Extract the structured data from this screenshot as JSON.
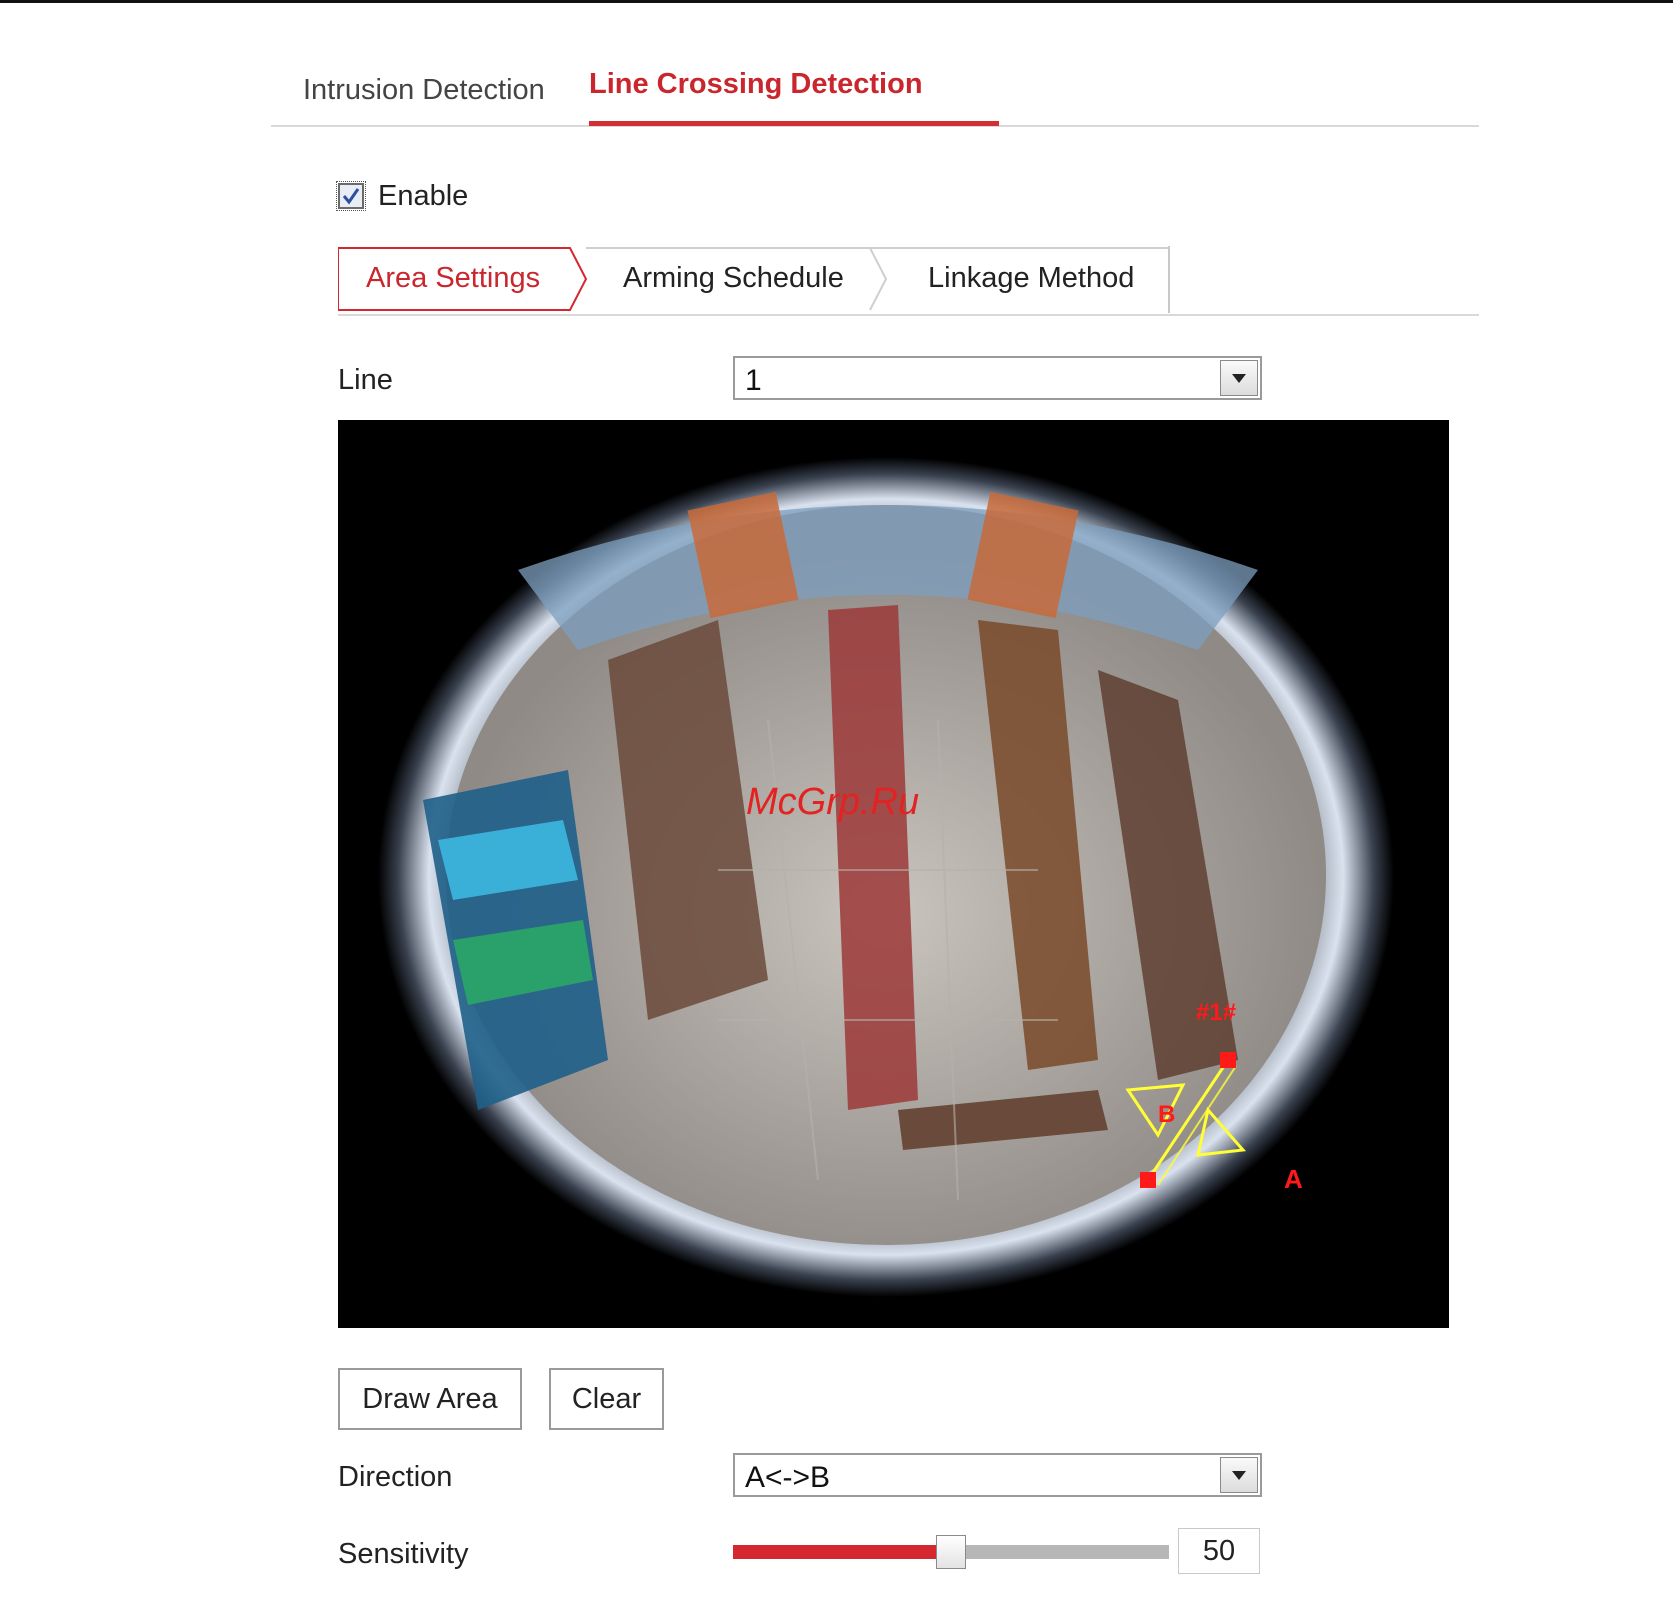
{
  "tabs": [
    {
      "label": "Intrusion Detection",
      "active": false
    },
    {
      "label": "Line Crossing Detection",
      "active": true
    }
  ],
  "enable": {
    "label": "Enable",
    "checked": true
  },
  "subtabs": [
    {
      "label": "Area Settings",
      "active": true
    },
    {
      "label": "Arming Schedule",
      "active": false
    },
    {
      "label": "Linkage Method",
      "active": false
    }
  ],
  "line": {
    "label": "Line",
    "value": "1"
  },
  "video": {
    "watermark": "McGrp.Ru",
    "line_id_label": "#1#",
    "point_a": "A",
    "point_b": "B"
  },
  "buttons": {
    "draw_area": "Draw Area",
    "clear": "Clear"
  },
  "direction": {
    "label": "Direction",
    "value": "A<->B"
  },
  "sensitivity": {
    "label": "Sensitivity",
    "value": "50",
    "percent": 50
  },
  "colors": {
    "accent": "#d32f37",
    "line_yellow": "#ffff33",
    "marker_red": "#ff1a1a"
  }
}
